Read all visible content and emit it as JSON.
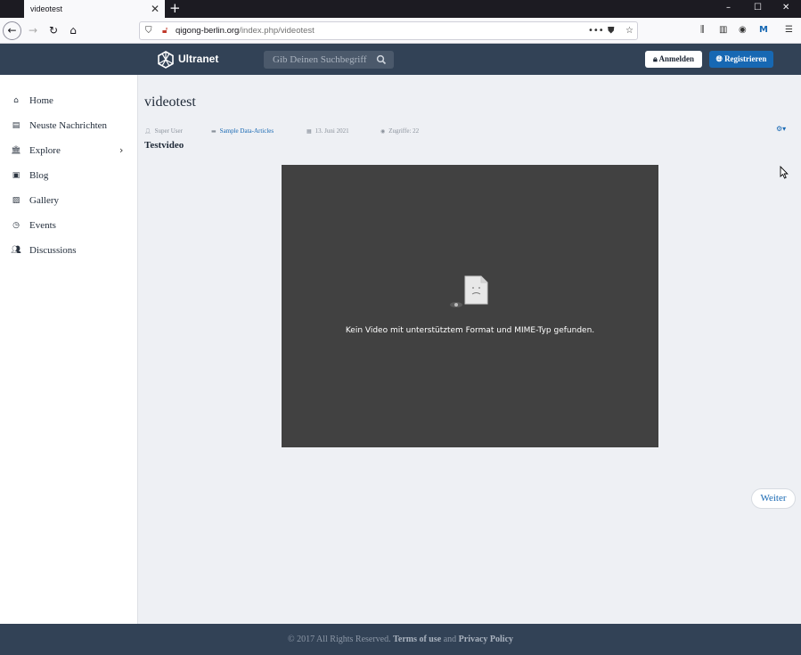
{
  "browser": {
    "tab_title": "videotest",
    "tab_close": "✕",
    "new_tab": "+",
    "url_host": "qigong-berlin.org",
    "url_path": "/index.php/videotest",
    "window_controls": [
      "–",
      "☐",
      "✕"
    ]
  },
  "header": {
    "brand": "Ultranet",
    "search_placeholder": "Gib Deinen Suchbegriff",
    "login_label": "Anmelden",
    "register_label": "Registrieren"
  },
  "sidebar": {
    "items": [
      {
        "label": "Home",
        "icon": "home-icon"
      },
      {
        "label": "Neuste Nachrichten",
        "icon": "newspaper-icon"
      },
      {
        "label": "Explore",
        "icon": "bank-icon"
      },
      {
        "label": "Blog",
        "icon": "blog-icon"
      },
      {
        "label": "Gallery",
        "icon": "image-icon"
      },
      {
        "label": "Events",
        "icon": "clock-icon"
      },
      {
        "label": "Discussions",
        "icon": "users-icon"
      }
    ]
  },
  "article": {
    "title": "videotest",
    "author": "Super User",
    "category": "Sample Data-Articles",
    "date": "13. Juni 2021",
    "hits": "Zugriffe: 22",
    "subtitle": "Testvideo",
    "video_message": "Kein Video mit unterstütztem Format und MIME-Typ gefunden.",
    "next_label": "Weiter"
  },
  "footer": {
    "copyright": "© 2017 All Rights Reserved.",
    "terms": "Terms of use",
    "and": "and",
    "privacy": "Privacy Policy"
  },
  "colors": {
    "header_bg": "#324256",
    "accent": "#1768b3",
    "video_bg": "#414141"
  }
}
